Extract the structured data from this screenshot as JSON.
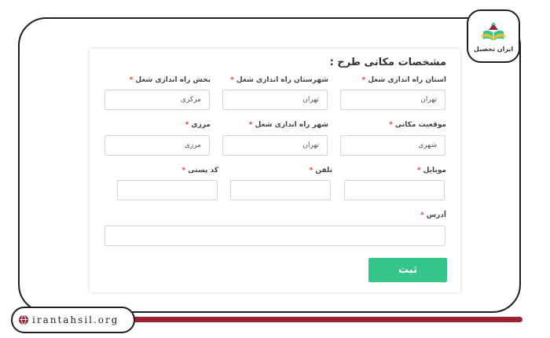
{
  "brand": {
    "logo_text": "ایران تحصیل",
    "website": "irantahsil.org"
  },
  "colors": {
    "submit": "#35c58b",
    "required": "#e53935",
    "accent_bar": "#9b2335"
  },
  "form": {
    "title": "مشخصات مکانی طرح :",
    "required_mark": "*",
    "fields": {
      "province": {
        "label": "استان راه اندازی شغل",
        "value": "تهران"
      },
      "county": {
        "label": "شهرستان راه اندازی شغل",
        "value": "تهران"
      },
      "district": {
        "label": "بخش راه اندازی شغل",
        "value": "مرکزی"
      },
      "location_type": {
        "label": "موقعیت مکانی",
        "value": "شهری"
      },
      "city": {
        "label": "شهر راه اندازی شغل",
        "value": "تهران"
      },
      "border": {
        "label": "مرزی",
        "value": "مرزی"
      },
      "mobile": {
        "label": "موبایل",
        "value": ""
      },
      "phone": {
        "label": "تلفن",
        "value": ""
      },
      "postal_code": {
        "label": "کد پستی",
        "value": ""
      },
      "address": {
        "label": "آدرس",
        "value": ""
      }
    },
    "submit_label": "ثبت"
  }
}
